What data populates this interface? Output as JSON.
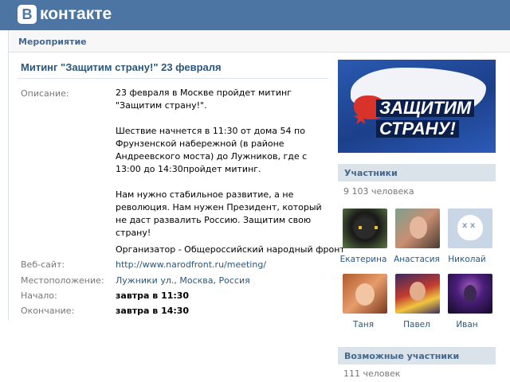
{
  "header": {
    "logo_letter": "В",
    "logo_text": "контакте"
  },
  "breadcrumb": "Мероприятие",
  "event": {
    "title": "Митинг \"Защитим страну!\" 23 февраля",
    "labels": {
      "description": "Описание:",
      "website": "Веб-сайт:",
      "location": "Местоположение:",
      "start": "Начало:",
      "end": "Окончание:"
    },
    "description": [
      "23 февраля в Москве пройдет митинг \"Защитим страну!\".",
      "Шествие начнется в 11:30 от дома 54 по Фрунзенской набережной (в районе Андреевского моста) до Лужников, где с 13:00 до 14:30пройдет митинг.",
      "Нам нужно стабильное развитие, а не революция. Нам нужен Президент, который не даст развалить Россию. Защитим свою страну!"
    ],
    "organizer": "Организатор - Общероссийский народный фронт",
    "website": "http://www.narodfront.ru/meeting/",
    "location_street": "Лужники ул.",
    "location_city": "Москва",
    "location_country": "Россия",
    "start": "завтра в 11:30",
    "end": "завтра в 14:30"
  },
  "banner": {
    "line1": "ЗАЩИТИМ",
    "line2": "СТРАНУ!"
  },
  "members": {
    "title": "Участники",
    "count": "9 103 человека",
    "list": [
      {
        "name": "Екатерина",
        "icon": "cat-photo"
      },
      {
        "name": "Анастасия",
        "icon": "person-photo"
      },
      {
        "name": "Николай",
        "icon": "default-dog-avatar"
      },
      {
        "name": "Таня",
        "icon": "person-photo"
      },
      {
        "name": "Павел",
        "icon": "person-photo"
      },
      {
        "name": "Иван",
        "icon": "person-photo"
      }
    ]
  },
  "possible_members": {
    "title": "Возможные участники",
    "count": "111 человек"
  },
  "colors": {
    "header": "#4c75a3",
    "link": "#2b587a",
    "label": "#777777",
    "side_head": "#dae2ea"
  }
}
